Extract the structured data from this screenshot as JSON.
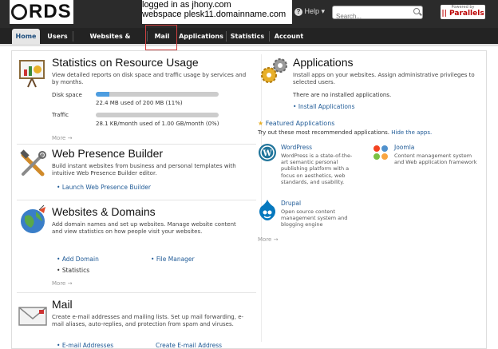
{
  "header": {
    "logo_text": "RDS",
    "login_line1": "logged in as jhony.com",
    "login_line2": "webspace plesk11.domainname.com",
    "help_label": "Help",
    "help_arrow": "▾",
    "search_placeholder": "Search...",
    "parallels_powered": "Powered by",
    "parallels_brand": "|| Parallels"
  },
  "tabs": [
    {
      "label": "Home"
    },
    {
      "label": "Users"
    },
    {
      "label": "Websites & Domains"
    },
    {
      "label": "Mail"
    },
    {
      "label": "Applications"
    },
    {
      "label": "Statistics"
    },
    {
      "label": "Account"
    }
  ],
  "stats": {
    "title": "Statistics on Resource Usage",
    "desc": "View detailed reports on disk space and traffic usage by services and by months.",
    "disk_label": "Disk space",
    "disk_value": "22.4 MB used of 200 MB (11%)",
    "disk_fraction": 0.11,
    "traffic_label": "Traffic",
    "traffic_value": "28.1 KB/month used of 1.00 GB/month (0%)",
    "traffic_fraction": 0.0,
    "more": "More →"
  },
  "wpb": {
    "title": "Web Presence Builder",
    "desc": "Build instant websites from business and personal templates with intuitive Web Presence Builder editor.",
    "link": "Launch Web Presence Builder"
  },
  "domains": {
    "title": "Websites & Domains",
    "desc": "Add domain names and set up websites. Manage website content and view statistics on how people visit your websites.",
    "link1": "Add Domain",
    "link2": "File Manager",
    "link3": "Statistics",
    "more": "More →"
  },
  "mail": {
    "title": "Mail",
    "desc": "Create e-mail addresses and mailing lists. Set up mail forwarding, e-mail aliases, auto-replies, and protection from spam and viruses.",
    "link1": "E-mail Addresses",
    "link2": "Create E-mail Address"
  },
  "apps": {
    "title": "Applications",
    "desc": "Install apps on your websites. Assign administrative privileges to selected users.",
    "none": "There are no installed applications.",
    "install": "Install Applications",
    "featured_title": "Featured Applications",
    "featured_desc": "Try out these most recommended applications.",
    "hide": "Hide the apps.",
    "wordpress_name": "WordPress",
    "wordpress_desc": "WordPress is a state-of-the-art semantic personal publishing platform with a focus on aesthetics, web standards, and usability.",
    "joomla_name": "Joomla",
    "joomla_desc": "Content management system and Web application framework",
    "drupal_name": "Drupal",
    "drupal_desc": "Open source content management system and blogging engine",
    "more": "More →"
  },
  "colors": {
    "topbar": "#2b2b2b",
    "link": "#1f5a96",
    "bar_fill": "#4d9de0",
    "highlight": "#d04040"
  }
}
